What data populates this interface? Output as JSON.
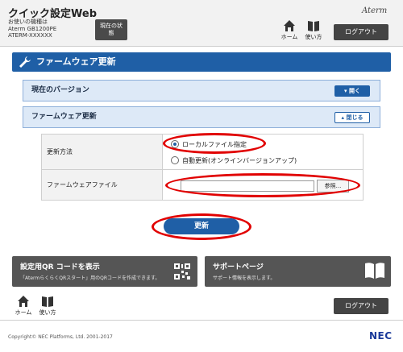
{
  "header": {
    "app_title": "クイック設定Web",
    "device_label": "お使いの機種は",
    "device_model": "Aterm GB1200PE",
    "device_name": "ATERM-XXXXXX",
    "status_button_label": "現在の状態",
    "brand": "Aterm",
    "home_label": "ホーム",
    "manual_label": "使い方",
    "logout_label": "ログアウト"
  },
  "section": {
    "title": "ファームウェア更新"
  },
  "panels": [
    {
      "label": "現在のバージョン",
      "button_label": "開く",
      "state": "collapsed"
    },
    {
      "label": "ファームウェア更新",
      "button_label": "閉じる",
      "state": "expanded"
    }
  ],
  "settings": {
    "method_label": "更新方法",
    "options": [
      {
        "label": "ローカルファイル指定",
        "checked": true
      },
      {
        "label": "自動更新(オンラインバージョンアップ)",
        "checked": false
      }
    ],
    "file_label": "ファームウェアファイル",
    "file_value": "",
    "browse_label": "参照..."
  },
  "update_button_label": "更新",
  "cards": [
    {
      "title": "設定用QR コードを表示",
      "desc": "「AtermらくらくQRスタート」用のQRコードを作成できます。",
      "icon": "qr-code-icon"
    },
    {
      "title": "サポートページ",
      "desc": "サポート情報を表示します。",
      "icon": "book-icon"
    }
  ],
  "footer": {
    "home_label": "ホーム",
    "manual_label": "使い方",
    "logout_label": "ログアウト",
    "copyright": "Copyright© NEC Platforms, Ltd. 2001-2017",
    "logo": "NEC"
  },
  "colors": {
    "accent": "#1f5fa6",
    "panel_bg": "#dde9f7",
    "annotation": "#e10000",
    "dark_button": "#444444"
  }
}
